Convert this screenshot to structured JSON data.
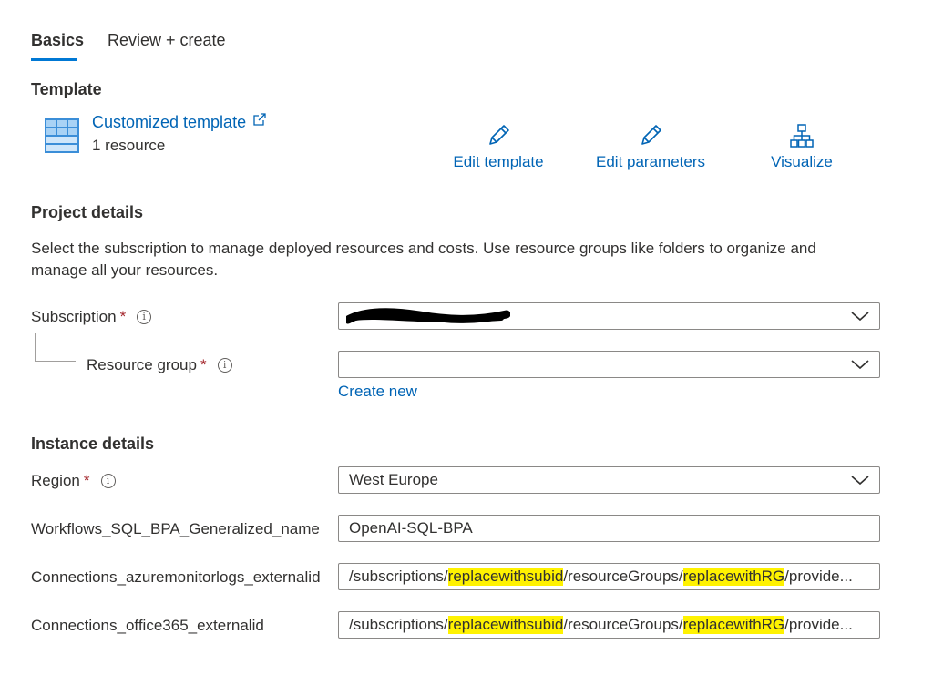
{
  "tabs": [
    {
      "label": "Basics",
      "active": true
    },
    {
      "label": "Review + create",
      "active": false
    }
  ],
  "template": {
    "section_title": "Template",
    "template_link": "Customized template",
    "resource_count": "1 resource",
    "actions": {
      "edit_template": "Edit template",
      "edit_parameters": "Edit parameters",
      "visualize": "Visualize"
    }
  },
  "project": {
    "section_title": "Project details",
    "description": "Select the subscription to manage deployed resources and costs. Use resource groups like folders to organize and manage all your resources.",
    "subscription_label": "Subscription",
    "resource_group_label": "Resource group",
    "required_marker": "*",
    "info_glyph": "i",
    "create_new": "Create new",
    "resource_group_value": ""
  },
  "instance": {
    "section_title": "Instance details",
    "region_label": "Region",
    "region_value": "West Europe",
    "workflow_label": "Workflows_SQL_BPA_Generalized_name",
    "workflow_value": "OpenAI-SQL-BPA",
    "azuremonitor_label": "Connections_azuremonitorlogs_externalid",
    "office365_label": "Connections_office365_externalid",
    "externalid_value": {
      "prefix": "/subscriptions/",
      "subid": "replacewithsubid",
      "mid": "/resourceGroups/",
      "rg": "replacewithRG",
      "suffix": "/provide..."
    }
  },
  "colors": {
    "accent": "#0078d4",
    "link": "#0064b5",
    "required": "#a4262c",
    "highlight": "#fff200"
  },
  "icons": [
    "grid-template-icon",
    "external-link-icon",
    "pencil-icon",
    "hierarchy-icon",
    "chevron-down-icon",
    "info-icon",
    "redaction-scribble"
  ]
}
